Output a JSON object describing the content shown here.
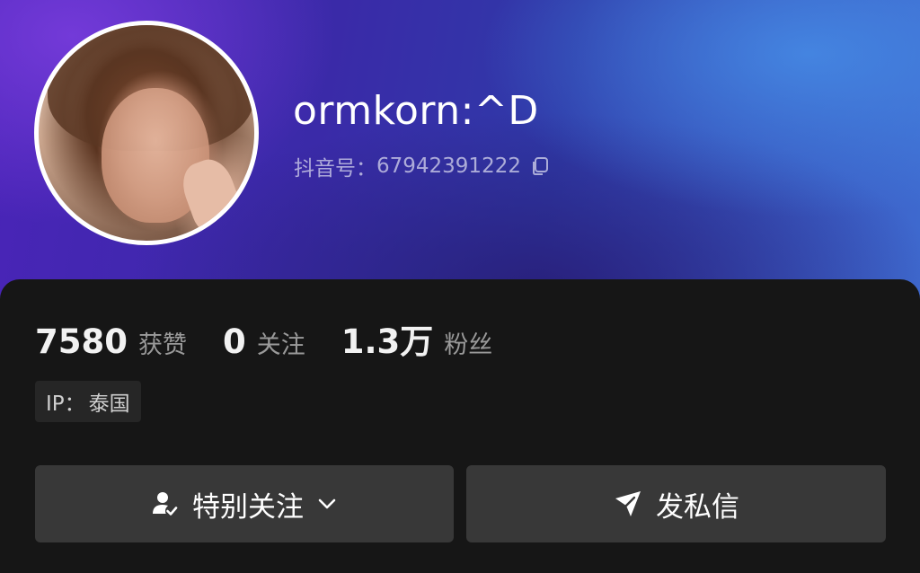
{
  "profile": {
    "username": "ormkorn:^D",
    "douyin_id_label": "抖音号：",
    "douyin_id": "67942391222"
  },
  "stats": [
    {
      "value": "7580",
      "label": "获赞"
    },
    {
      "value": "0",
      "label": "关注"
    },
    {
      "value": "1.3万",
      "label": "粉丝"
    }
  ],
  "ip": {
    "label": "IP：",
    "value": "泰国"
  },
  "actions": {
    "follow_label": "特别关注",
    "message_label": "发私信"
  },
  "icons": {
    "copy": "copy-icon",
    "user_check": "user-check-icon",
    "chevron": "chevron-down-icon",
    "send": "send-icon"
  },
  "colors": {
    "banner_start": "#4a24b8",
    "banner_end": "#3f6bd0",
    "panel_bg": "#161616",
    "button_bg": "#383838"
  }
}
